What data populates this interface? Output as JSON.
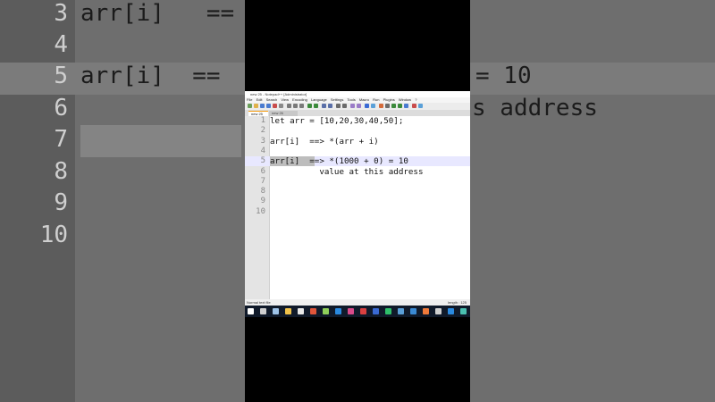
{
  "background": {
    "lines": [
      {
        "num": "3",
        "code": "arr[i]   =="
      },
      {
        "num": "4",
        "code": ""
      },
      {
        "num": "5",
        "code": "arr[i]  ==",
        "right": "= 10",
        "highlight": true
      },
      {
        "num": "6",
        "code": "",
        "right": "s address"
      },
      {
        "num": "7",
        "code": ""
      },
      {
        "num": "8",
        "code": ""
      },
      {
        "num": "9",
        "code": ""
      },
      {
        "num": "10",
        "code": ""
      }
    ]
  },
  "window": {
    "title": "new 25 - Notepad++ [Administrator]",
    "menu": [
      "File",
      "Edit",
      "Search",
      "View",
      "Encoding",
      "Language",
      "Settings",
      "Tools",
      "Macro",
      "Run",
      "Plugins",
      "Window",
      "?"
    ],
    "tabs": [
      {
        "label": "new 25",
        "active": true
      },
      {
        "label": "new 26",
        "active": false
      }
    ]
  },
  "editor": {
    "lines": [
      {
        "num": "1",
        "text": "let arr = [10,20,30,40,50];"
      },
      {
        "num": "2",
        "text": ""
      },
      {
        "num": "3",
        "text": "arr[i]  ==> *(arr + i)"
      },
      {
        "num": "4",
        "text": ""
      },
      {
        "num": "5",
        "text": "arr[i]  ==> *(1000 + 0) = 10",
        "current": true
      },
      {
        "num": "6",
        "text": "          value at this address"
      },
      {
        "num": "7",
        "text": ""
      },
      {
        "num": "8",
        "text": ""
      },
      {
        "num": "9",
        "text": ""
      },
      {
        "num": "10",
        "text": ""
      }
    ]
  },
  "status": {
    "left": "Normal text file",
    "right": "length : 125"
  },
  "colors": {
    "bg": "#6e6e6e",
    "editor_bg": "#ffffff",
    "current_line": "#e8e8ff",
    "taskbar": "#101a2a"
  }
}
